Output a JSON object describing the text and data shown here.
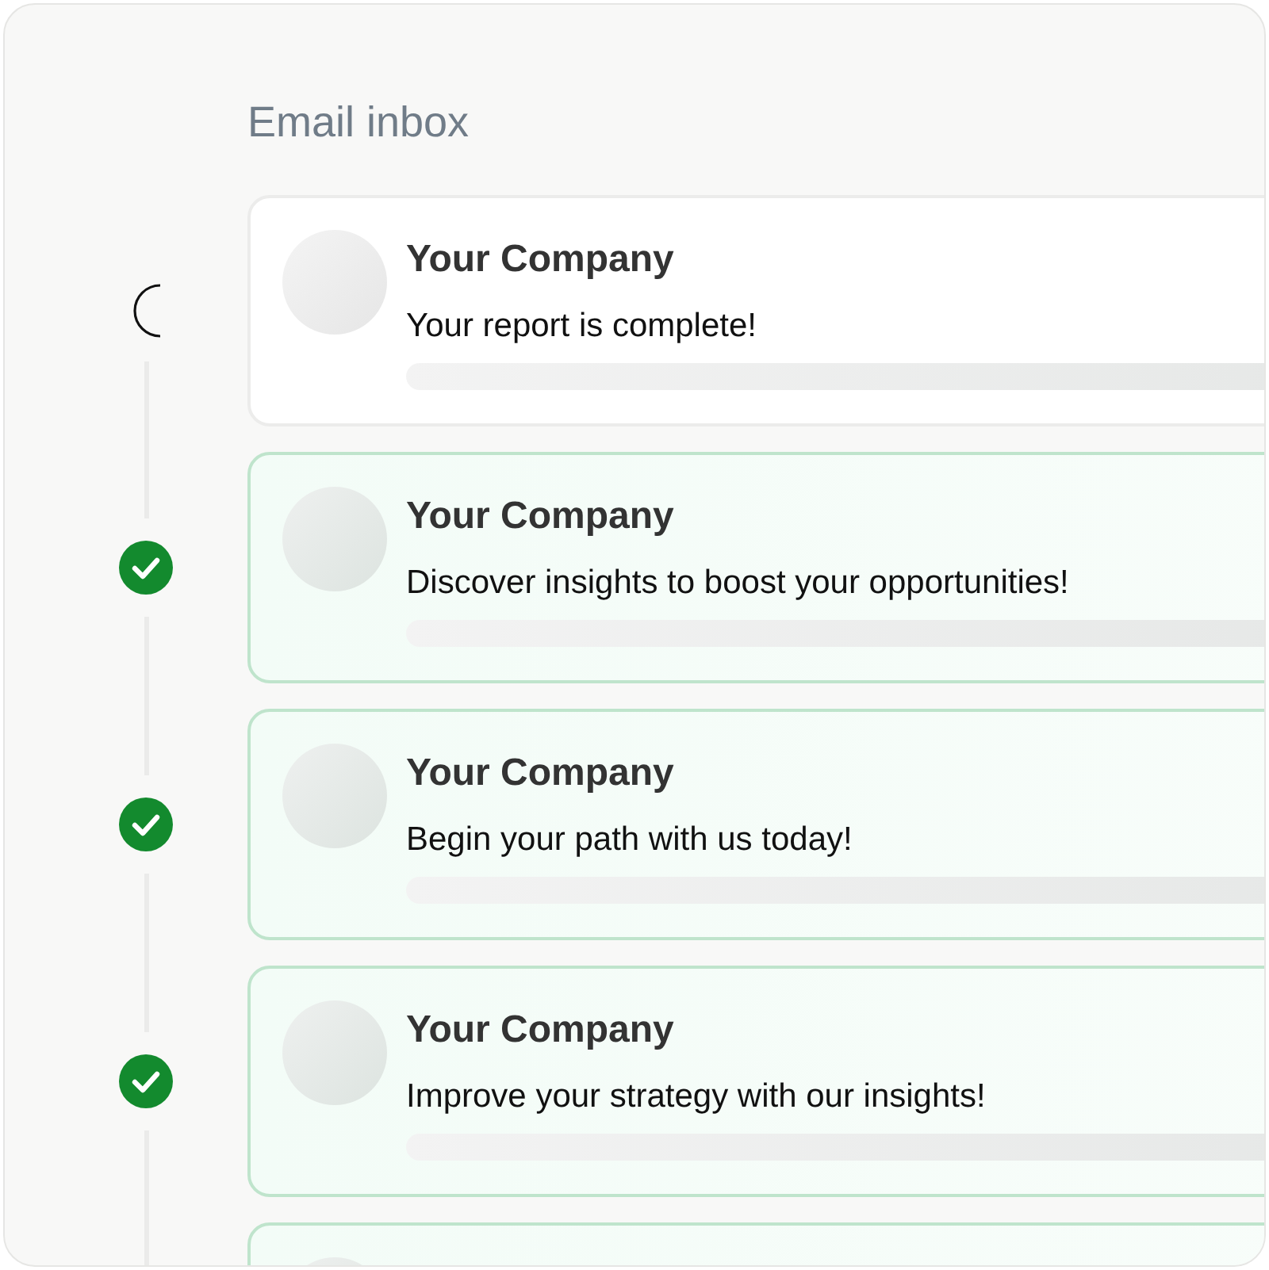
{
  "title": "Email inbox",
  "emails": [
    {
      "sender": "Your Company",
      "subject": "Your report is complete!",
      "completed": false
    },
    {
      "sender": "Your Company",
      "subject": "Discover insights to boost your opportunities!",
      "completed": true
    },
    {
      "sender": "Your Company",
      "subject": "Begin your path with us today!",
      "completed": true
    },
    {
      "sender": "Your Company",
      "subject": "Improve your strategy with our insights!",
      "completed": true
    },
    {
      "completed": true
    }
  ]
}
